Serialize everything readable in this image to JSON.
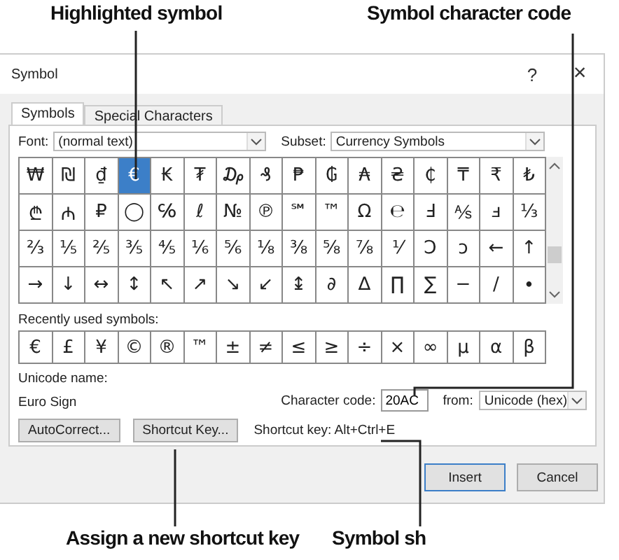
{
  "callouts_top": [
    "Highlighted symbol",
    "Symbol character code"
  ],
  "window": {
    "title": "Symbol",
    "help": "?",
    "close": "×"
  },
  "tabs": [
    {
      "label": "Symbols",
      "selected": true
    },
    {
      "label": "Special Characters",
      "selected": false
    }
  ],
  "font": {
    "label": "Font:",
    "value": "(normal text)"
  },
  "subset": {
    "label": "Subset:",
    "value": "Currency Symbols"
  },
  "grid": [
    [
      {
        "c": "₩",
        "selected": false
      },
      {
        "c": "₪",
        "selected": false
      },
      {
        "c": "₫",
        "selected": false
      },
      {
        "c": "€",
        "selected": true
      },
      {
        "c": "₭",
        "selected": false
      },
      {
        "c": "₮",
        "selected": false
      },
      {
        "c": "₯",
        "selected": false
      },
      {
        "c": "₰",
        "selected": false
      },
      {
        "c": "₱",
        "selected": false
      },
      {
        "c": "₲",
        "selected": false
      },
      {
        "c": "₳",
        "selected": false
      },
      {
        "c": "₴",
        "selected": false
      },
      {
        "c": "₵",
        "selected": false
      },
      {
        "c": "₸",
        "selected": false
      },
      {
        "c": "₹",
        "selected": false
      },
      {
        "c": "₺",
        "selected": false
      }
    ],
    [
      {
        "c": "₾",
        "selected": false
      },
      {
        "c": "₼",
        "selected": false
      },
      {
        "c": "₽",
        "selected": false
      },
      {
        "c": "◯",
        "selected": false
      },
      {
        "c": "℅",
        "selected": false
      },
      {
        "c": "ℓ",
        "selected": false
      },
      {
        "c": "№",
        "selected": false
      },
      {
        "c": "℗",
        "selected": false
      },
      {
        "c": "℠",
        "selected": false
      },
      {
        "c": "™",
        "selected": false
      },
      {
        "c": "Ω",
        "selected": false
      },
      {
        "c": "℮",
        "selected": false
      },
      {
        "c": "Ⅎ",
        "selected": false
      },
      {
        "c": "⅍",
        "selected": false
      },
      {
        "c": "ⅎ",
        "selected": false
      },
      {
        "c": "⅓",
        "selected": false
      }
    ],
    [
      {
        "c": "⅔",
        "selected": false
      },
      {
        "c": "⅕",
        "selected": false
      },
      {
        "c": "⅖",
        "selected": false
      },
      {
        "c": "⅗",
        "selected": false
      },
      {
        "c": "⅘",
        "selected": false
      },
      {
        "c": "⅙",
        "selected": false
      },
      {
        "c": "⅚",
        "selected": false
      },
      {
        "c": "⅛",
        "selected": false
      },
      {
        "c": "⅜",
        "selected": false
      },
      {
        "c": "⅝",
        "selected": false
      },
      {
        "c": "⅞",
        "selected": false
      },
      {
        "c": "⅟",
        "selected": false
      },
      {
        "c": "Ↄ",
        "selected": false
      },
      {
        "c": "ↄ",
        "selected": false
      },
      {
        "c": "←",
        "selected": false
      },
      {
        "c": "↑",
        "selected": false
      }
    ],
    [
      {
        "c": "→",
        "selected": false
      },
      {
        "c": "↓",
        "selected": false
      },
      {
        "c": "↔",
        "selected": false
      },
      {
        "c": "↕",
        "selected": false
      },
      {
        "c": "↖",
        "selected": false
      },
      {
        "c": "↗",
        "selected": false
      },
      {
        "c": "↘",
        "selected": false
      },
      {
        "c": "↙",
        "selected": false
      },
      {
        "c": "↨",
        "selected": false
      },
      {
        "c": "∂",
        "selected": false
      },
      {
        "c": "∆",
        "selected": false
      },
      {
        "c": "∏",
        "selected": false
      },
      {
        "c": "∑",
        "selected": false
      },
      {
        "c": "−",
        "selected": false
      },
      {
        "c": "∕",
        "selected": false
      },
      {
        "c": "∙",
        "selected": false
      }
    ]
  ],
  "recent": {
    "label": "Recently used symbols:",
    "symbols": [
      "€",
      "£",
      "¥",
      "©",
      "®",
      "™",
      "±",
      "≠",
      "≤",
      "≥",
      "÷",
      "×",
      "∞",
      "µ",
      "α",
      "β"
    ]
  },
  "unicode_name": {
    "label": "Unicode name:",
    "value": "Euro Sign"
  },
  "character_code": {
    "label": "Character code:",
    "value": "20AC"
  },
  "from": {
    "label": "from:",
    "value": "Unicode (hex)"
  },
  "buttons": [
    "AutoCorrect...",
    "Shortcut Key..."
  ],
  "shortcut": "Shortcut key: Alt+Ctrl+E",
  "footer_buttons": [
    {
      "label": "Insert",
      "default": true
    },
    {
      "label": "Cancel",
      "default": false
    }
  ],
  "callouts_bottom": [
    "Assign a new shortcut key",
    "Symbol sh"
  ]
}
